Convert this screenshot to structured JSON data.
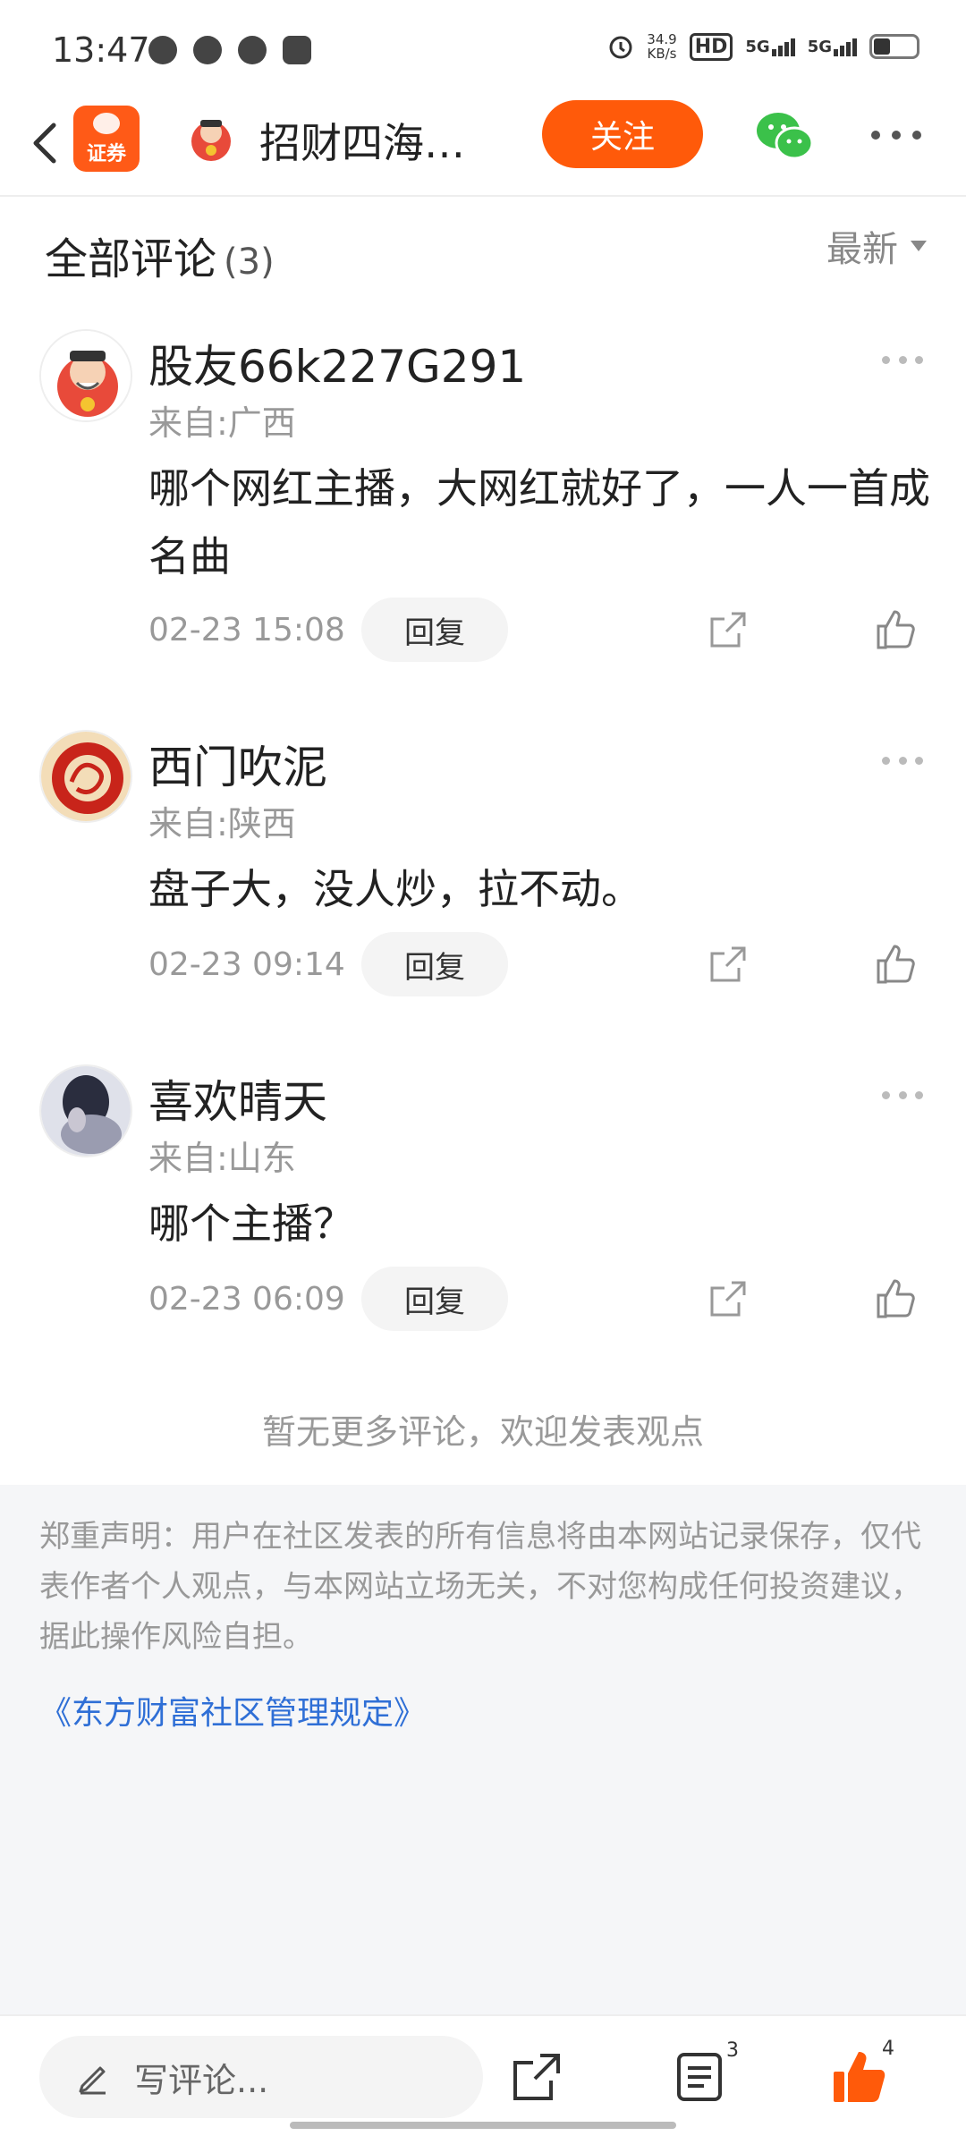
{
  "status_bar": {
    "time": "13:47",
    "net_speed_value": "34.9",
    "net_speed_unit": "KB/s",
    "hd_label": "HD",
    "sim1": "5G",
    "sim2": "5G",
    "battery_level": 0.35,
    "left_icons": [
      "wechat-icon",
      "app-icon",
      "telegram-icon",
      "app2-icon"
    ]
  },
  "nav": {
    "logo_label": "证券",
    "author_name": "招财四海…",
    "follow_label": "关注",
    "colors": {
      "accent": "#ff5a0a",
      "wechat": "#3bc14a"
    }
  },
  "comments_header": {
    "title": "全部评论",
    "count": "(3)",
    "sort_label": "最新"
  },
  "comments": [
    {
      "user": "股友66k227G291",
      "origin": "来自:广西",
      "body": "哪个网红主播，大网红就好了，一人一首成名曲",
      "time": "02-23 15:08",
      "reply": "回复"
    },
    {
      "user": "西门吹泥",
      "origin": "来自:陕西",
      "body": "盘子大，没人炒，拉不动。",
      "time": "02-23 09:14",
      "reply": "回复"
    },
    {
      "user": "喜欢晴天",
      "origin": "来自:山东",
      "body": "哪个主播？",
      "time": "02-23 06:09",
      "reply": "回复"
    }
  ],
  "no_more_text": "暂无更多评论，欢迎发表观点",
  "disclaimer": {
    "text": "郑重声明：用户在社区发表的所有信息将由本网站记录保存，仅代表作者个人观点，与本网站立场无关，不对您构成任何投资建议，据此操作风险自担。",
    "link": "《东方财富社区管理规定》"
  },
  "bottom_bar": {
    "placeholder": "写评论...",
    "list_count": "3",
    "like_count": "4"
  }
}
